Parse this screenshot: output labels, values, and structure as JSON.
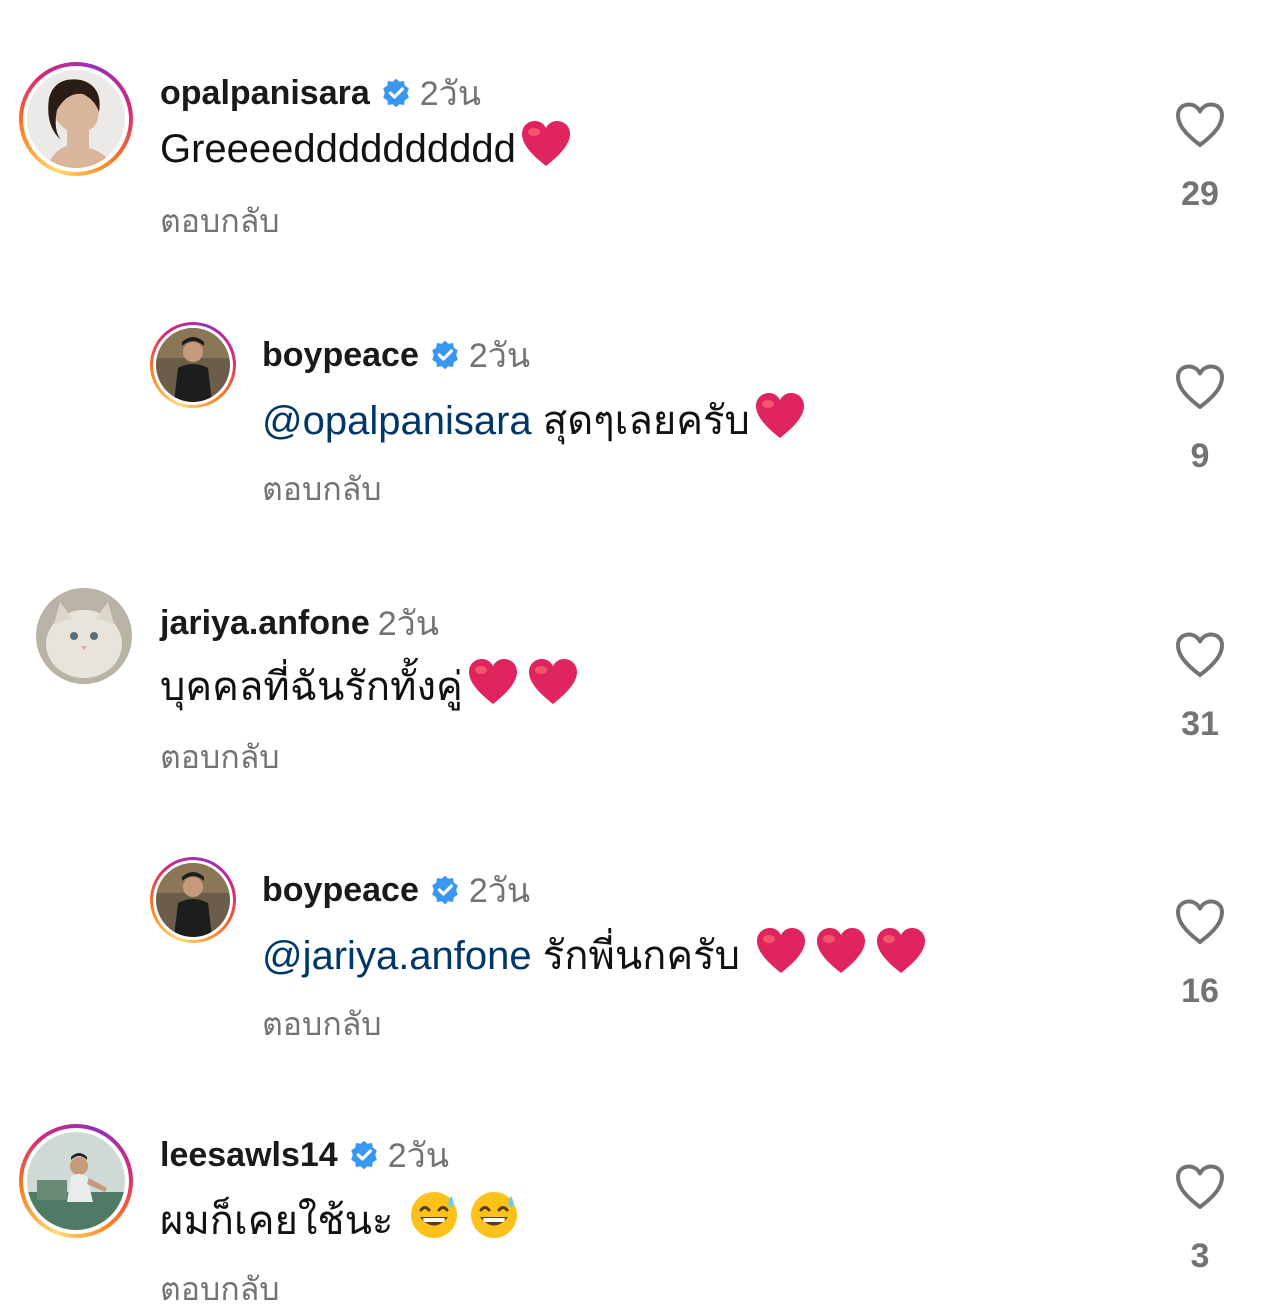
{
  "comments": [
    {
      "username": "opalpanisara",
      "time": "2วัน",
      "text": "Greeeedddddddddd",
      "reply": "ตอบกลับ",
      "likes": "29",
      "verified": true
    },
    {
      "username": "boypeace",
      "time": "2วัน",
      "mention": "@opalpanisara",
      "text": " สุดๆเลยครับ",
      "reply": "ตอบกลับ",
      "likes": "9",
      "verified": true
    },
    {
      "username": "jariya.anfone",
      "time": "2วัน",
      "text": "บุคคลที่ฉันรักทั้งคู่",
      "reply": "ตอบกลับ",
      "likes": "31",
      "verified": false
    },
    {
      "username": "boypeace",
      "time": "2วัน",
      "mention": "@jariya.anfone",
      "text": " รักพี่นกครับ ",
      "reply": "ตอบกลับ",
      "likes": "16",
      "verified": true
    },
    {
      "username": "leesawls14",
      "time": "2วัน",
      "text": "ผมก็เคยใช้นะ ",
      "reply": "ตอบกลับ",
      "likes": "3",
      "verified": true
    }
  ],
  "colors": {
    "verified": "#3897f0",
    "mention": "#00376b",
    "muted": "#737373",
    "heart_emoji": "#e0245e"
  },
  "icons": [
    "verified-badge-icon",
    "like-heart-icon",
    "red-heart-emoji",
    "sweat-smile-emoji"
  ]
}
